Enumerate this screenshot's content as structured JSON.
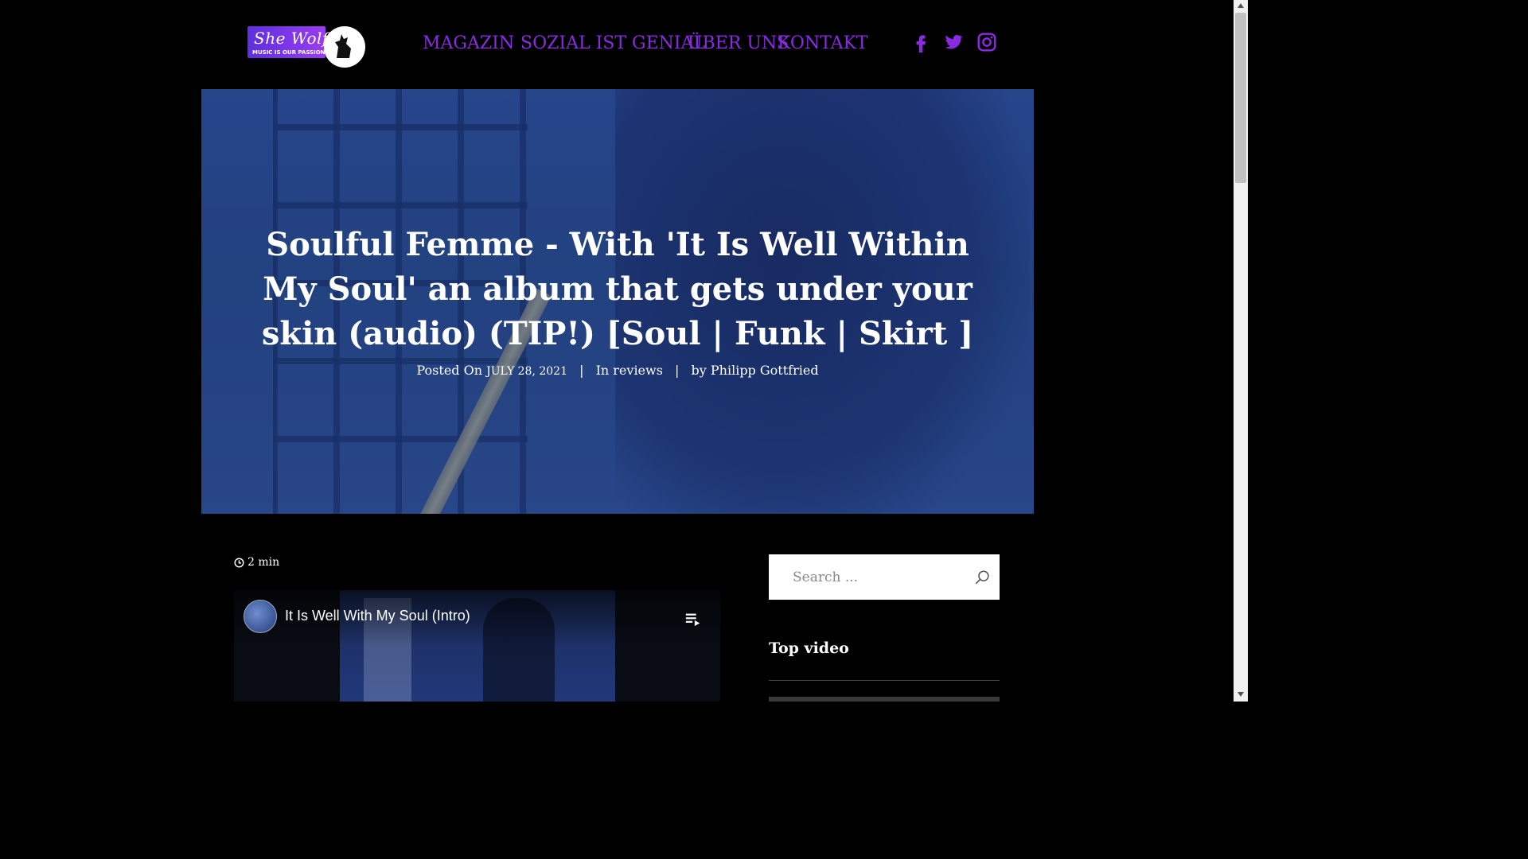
{
  "header": {
    "logo": {
      "brand": "She Wolf",
      "tagline": "MUSIC IS OUR PASSION"
    },
    "nav": [
      {
        "label": "MAGAZIN"
      },
      {
        "label": "SOZIAL IST GENIAL"
      },
      {
        "label": "ÜBER UNS"
      },
      {
        "label": "KONTAKT"
      }
    ],
    "social": [
      "facebook-icon",
      "twitter-icon",
      "instagram-icon"
    ],
    "accent_color": "#8a2be2"
  },
  "hero": {
    "title": "Soulful Femme - With 'It Is Well Within My Soul' an album that gets under your skin (audio) (TIP!) [Soul | Funk | Skirt ]",
    "posted_prefix": "Posted On",
    "date": "JULY 28, 2021",
    "separator": "|",
    "category_prefix": "In",
    "category": "reviews",
    "author_prefix": "by",
    "author": "Philipp Gottfried"
  },
  "article": {
    "read_time": "2 min",
    "video": {
      "title": "It Is Well With My Soul (Intro)"
    }
  },
  "sidebar": {
    "search_placeholder": "Search ...",
    "top_video_heading": "Top video"
  }
}
